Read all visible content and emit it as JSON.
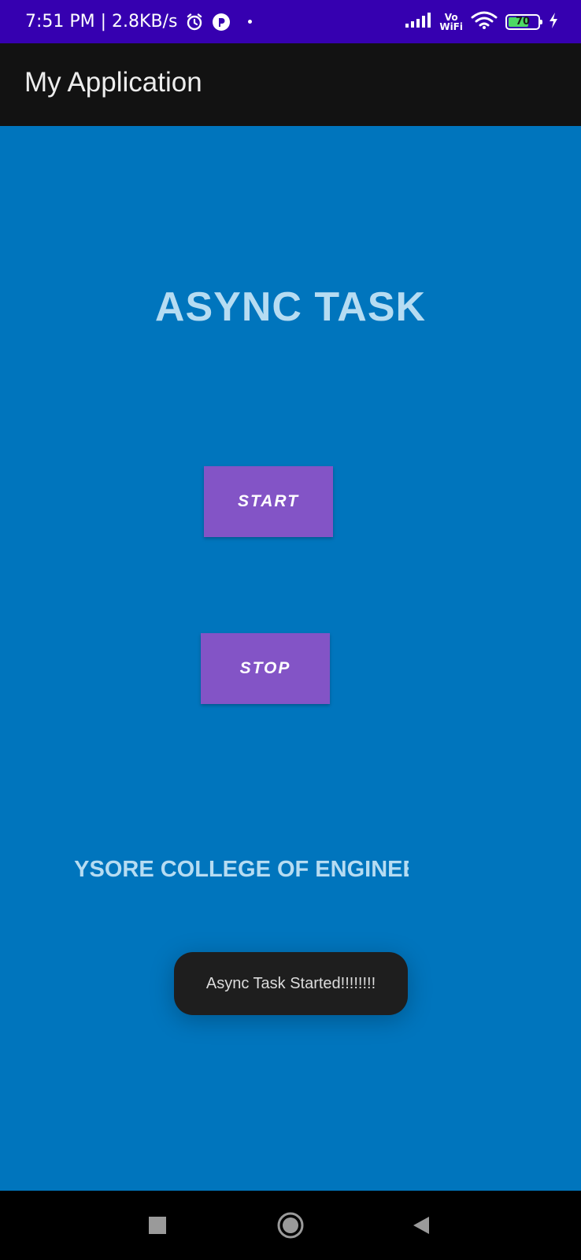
{
  "status_bar": {
    "time_speed": "7:51 PM | 2.8KB/s",
    "vo": "Vo",
    "wifi_label": "WiFi",
    "battery_level": "70",
    "icons": [
      "alarm-icon",
      "app-notification-icon",
      "signal-icon",
      "wifi-icon",
      "battery-icon",
      "charging-icon"
    ]
  },
  "app_bar": {
    "title": "My Application"
  },
  "main": {
    "heading": "ASYNC TASK",
    "start_label": "START",
    "stop_label": "STOP",
    "marquee_text": "MYSORE COLLEGE OF ENGINEERING"
  },
  "toast": {
    "message": "Async Task Started!!!!!!!!"
  },
  "nav_bar": {
    "icons": [
      "recent-apps-icon",
      "home-icon",
      "back-icon"
    ]
  },
  "colors": {
    "status_bar": "#3600b0",
    "app_bar": "#121212",
    "background": "#0075bd",
    "button": "#8354c6",
    "heading_text": "#b6dcf2",
    "toast": "#1e1e1e"
  }
}
